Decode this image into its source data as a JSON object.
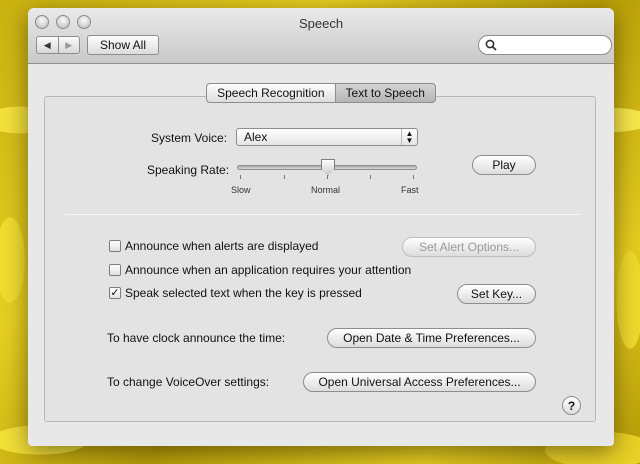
{
  "window": {
    "title": "Speech"
  },
  "toolbar": {
    "back_icon": "◀",
    "forward_icon": "▶",
    "show_all_label": "Show All",
    "search_value": "",
    "search_placeholder": ""
  },
  "tabs": [
    {
      "label": "Speech Recognition",
      "selected": false
    },
    {
      "label": "Text to Speech",
      "selected": true
    }
  ],
  "system_voice": {
    "label": "System Voice:",
    "value": "Alex"
  },
  "speaking_rate": {
    "label": "Speaking Rate:",
    "level": 0.5,
    "min_label": "Slow",
    "mid_label": "Normal",
    "max_label": "Fast"
  },
  "play_label": "Play",
  "options": [
    {
      "label": "Announce when alerts are displayed",
      "checked": false
    },
    {
      "label": "Announce when an application requires your attention",
      "checked": false
    },
    {
      "label": "Speak selected text when the key is pressed",
      "checked": true
    }
  ],
  "set_alert_options_label": "Set Alert Options...",
  "set_key_label": "Set Key...",
  "clock": {
    "label": "To have clock announce the time:",
    "button": "Open Date & Time Preferences..."
  },
  "voiceover": {
    "label": "To change VoiceOver settings:",
    "button": "Open Universal Access Preferences..."
  },
  "help_label": "?",
  "check_mark": "✓"
}
